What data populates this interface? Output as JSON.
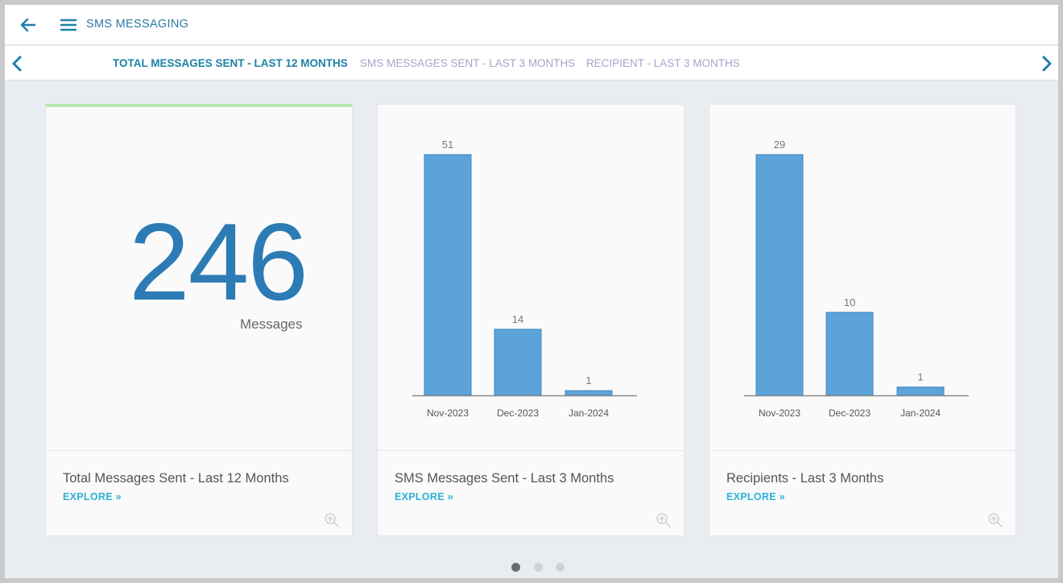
{
  "header": {
    "title": "SMS MESSAGING",
    "back_icon": "arrow-left-icon",
    "menu_icon": "hamburger-menu-icon",
    "accent_color": "#2a7aa0"
  },
  "tabs": [
    {
      "label": "TOTAL MESSAGES SENT - LAST 12 MONTHS",
      "active": true
    },
    {
      "label": "SMS MESSAGES SENT - LAST 3 MONTHS",
      "active": false
    },
    {
      "label": "RECIPIENT - LAST 3 MONTHS",
      "active": false
    }
  ],
  "cards": [
    {
      "kpi_value": "246",
      "kpi_unit": "Messages",
      "title": "Total Messages Sent - Last 12 Months",
      "explore_label": "EXPLORE »"
    },
    {
      "title": "SMS Messages Sent - Last 3 Months",
      "explore_label": "EXPLORE »"
    },
    {
      "title": "Recipients - Last 3 Months",
      "explore_label": "EXPLORE »"
    }
  ],
  "chart_data": [
    {
      "type": "bar",
      "categories": [
        "Nov-2023",
        "Dec-2023",
        "Jan-2024"
      ],
      "values": [
        51,
        14,
        1
      ],
      "data_labels": true,
      "bar_color": "#5ba3d9",
      "grid": false
    },
    {
      "type": "bar",
      "categories": [
        "Nov-2023",
        "Dec-2023",
        "Jan-2024"
      ],
      "values": [
        29,
        10,
        1
      ],
      "data_labels": true,
      "bar_color": "#5ba3d9",
      "grid": false
    }
  ],
  "pagination": {
    "total": 3,
    "current": 1
  }
}
